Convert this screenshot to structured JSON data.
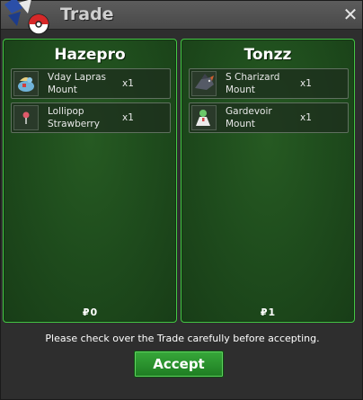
{
  "window": {
    "title": "Trade",
    "close_icon": "close-icon"
  },
  "left_panel": {
    "player_name": "Hazepro",
    "items": [
      {
        "name": "Vday Lapras Mount",
        "qty": "x1",
        "icon": "lapras-mount-icon"
      },
      {
        "name": "Lollipop Strawberry",
        "qty": "x1",
        "icon": "lollipop-icon"
      }
    ],
    "money_symbol": "₽",
    "money": "0"
  },
  "right_panel": {
    "player_name": "Tonzz",
    "items": [
      {
        "name": "S Charizard Mount",
        "qty": "x1",
        "icon": "charizard-mount-icon"
      },
      {
        "name": "Gardevoir Mount",
        "qty": "x1",
        "icon": "gardevoir-mount-icon"
      }
    ],
    "money_symbol": "₽",
    "money": "1"
  },
  "notice": "Please check over the Trade carefully before accepting.",
  "accept_label": "Accept",
  "colors": {
    "panel_border": "#44c844",
    "accept_green": "#2a9a2e"
  }
}
